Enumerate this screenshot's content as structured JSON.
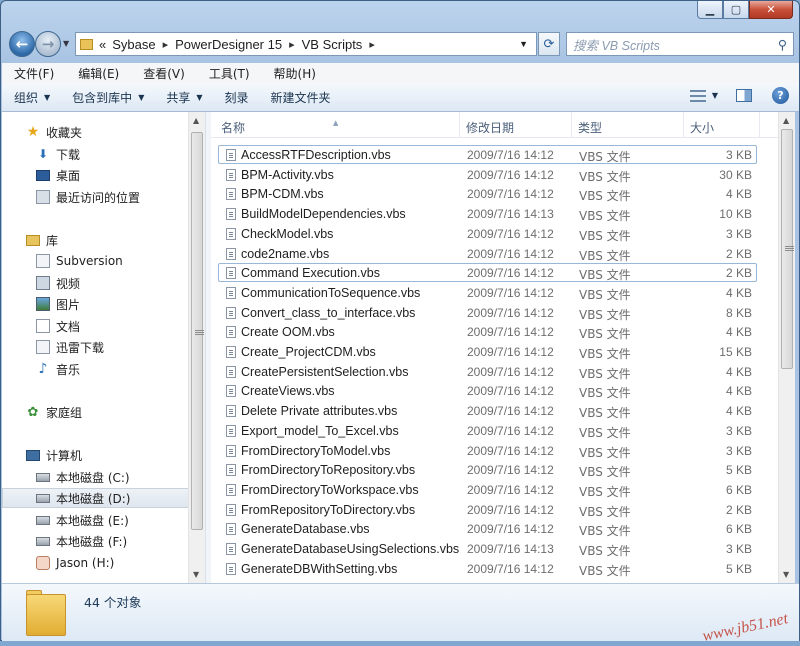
{
  "address": {
    "prefix": "«",
    "crumbs": [
      "Sybase",
      "PowerDesigner 15",
      "VB Scripts"
    ]
  },
  "search": {
    "placeholder": "搜索 VB Scripts"
  },
  "menu": [
    "文件(F)",
    "编辑(E)",
    "查看(V)",
    "工具(T)",
    "帮助(H)"
  ],
  "toolbar": {
    "organize": "组织",
    "include": "包含到库中",
    "share": "共享",
    "burn": "刻录",
    "new_folder": "新建文件夹"
  },
  "nav": {
    "favorites": "收藏夹",
    "downloads": "下载",
    "desktop": "桌面",
    "recent": "最近访问的位置",
    "library": "库",
    "subversion": "Subversion",
    "video": "视频",
    "pictures": "图片",
    "documents": "文档",
    "xunlei": "迅雷下载",
    "music": "音乐",
    "homegroup": "家庭组",
    "computer": "计算机",
    "drive_c": "本地磁盘 (C:)",
    "drive_d": "本地磁盘 (D:)",
    "drive_e": "本地磁盘 (E:)",
    "drive_f": "本地磁盘 (F:)",
    "jason": "Jason (H:)"
  },
  "columns": {
    "name": "名称",
    "date": "修改日期",
    "type": "类型",
    "size": "大小"
  },
  "files": [
    {
      "name": "AccessRTFDescription.vbs",
      "date": "2009/7/16 14:12",
      "type": "VBS 文件",
      "size": "3 KB"
    },
    {
      "name": "BPM-Activity.vbs",
      "date": "2009/7/16 14:12",
      "type": "VBS 文件",
      "size": "30 KB"
    },
    {
      "name": "BPM-CDM.vbs",
      "date": "2009/7/16 14:12",
      "type": "VBS 文件",
      "size": "4 KB"
    },
    {
      "name": "BuildModelDependencies.vbs",
      "date": "2009/7/16 14:13",
      "type": "VBS 文件",
      "size": "10 KB"
    },
    {
      "name": "CheckModel.vbs",
      "date": "2009/7/16 14:12",
      "type": "VBS 文件",
      "size": "3 KB"
    },
    {
      "name": "code2name.vbs",
      "date": "2009/7/16 14:12",
      "type": "VBS 文件",
      "size": "2 KB"
    },
    {
      "name": "Command Execution.vbs",
      "date": "2009/7/16 14:12",
      "type": "VBS 文件",
      "size": "2 KB"
    },
    {
      "name": "CommunicationToSequence.vbs",
      "date": "2009/7/16 14:12",
      "type": "VBS 文件",
      "size": "4 KB"
    },
    {
      "name": "Convert_class_to_interface.vbs",
      "date": "2009/7/16 14:12",
      "type": "VBS 文件",
      "size": "8 KB"
    },
    {
      "name": "Create OOM.vbs",
      "date": "2009/7/16 14:12",
      "type": "VBS 文件",
      "size": "4 KB"
    },
    {
      "name": "Create_ProjectCDM.vbs",
      "date": "2009/7/16 14:12",
      "type": "VBS 文件",
      "size": "15 KB"
    },
    {
      "name": "CreatePersistentSelection.vbs",
      "date": "2009/7/16 14:12",
      "type": "VBS 文件",
      "size": "4 KB"
    },
    {
      "name": "CreateViews.vbs",
      "date": "2009/7/16 14:12",
      "type": "VBS 文件",
      "size": "4 KB"
    },
    {
      "name": "Delete Private attributes.vbs",
      "date": "2009/7/16 14:12",
      "type": "VBS 文件",
      "size": "4 KB"
    },
    {
      "name": "Export_model_To_Excel.vbs",
      "date": "2009/7/16 14:12",
      "type": "VBS 文件",
      "size": "3 KB"
    },
    {
      "name": "FromDirectoryToModel.vbs",
      "date": "2009/7/16 14:12",
      "type": "VBS 文件",
      "size": "3 KB"
    },
    {
      "name": "FromDirectoryToRepository.vbs",
      "date": "2009/7/16 14:12",
      "type": "VBS 文件",
      "size": "5 KB"
    },
    {
      "name": "FromDirectoryToWorkspace.vbs",
      "date": "2009/7/16 14:12",
      "type": "VBS 文件",
      "size": "6 KB"
    },
    {
      "name": "FromRepositoryToDirectory.vbs",
      "date": "2009/7/16 14:12",
      "type": "VBS 文件",
      "size": "2 KB"
    },
    {
      "name": "GenerateDatabase.vbs",
      "date": "2009/7/16 14:12",
      "type": "VBS 文件",
      "size": "6 KB"
    },
    {
      "name": "GenerateDatabaseUsingSelections.vbs",
      "date": "2009/7/16 14:13",
      "type": "VBS 文件",
      "size": "3 KB"
    },
    {
      "name": "GenerateDBWithSetting.vbs",
      "date": "2009/7/16 14:12",
      "type": "VBS 文件",
      "size": "5 KB"
    }
  ],
  "status": {
    "count": "44 个对象"
  },
  "watermark": "www.jb51.net"
}
